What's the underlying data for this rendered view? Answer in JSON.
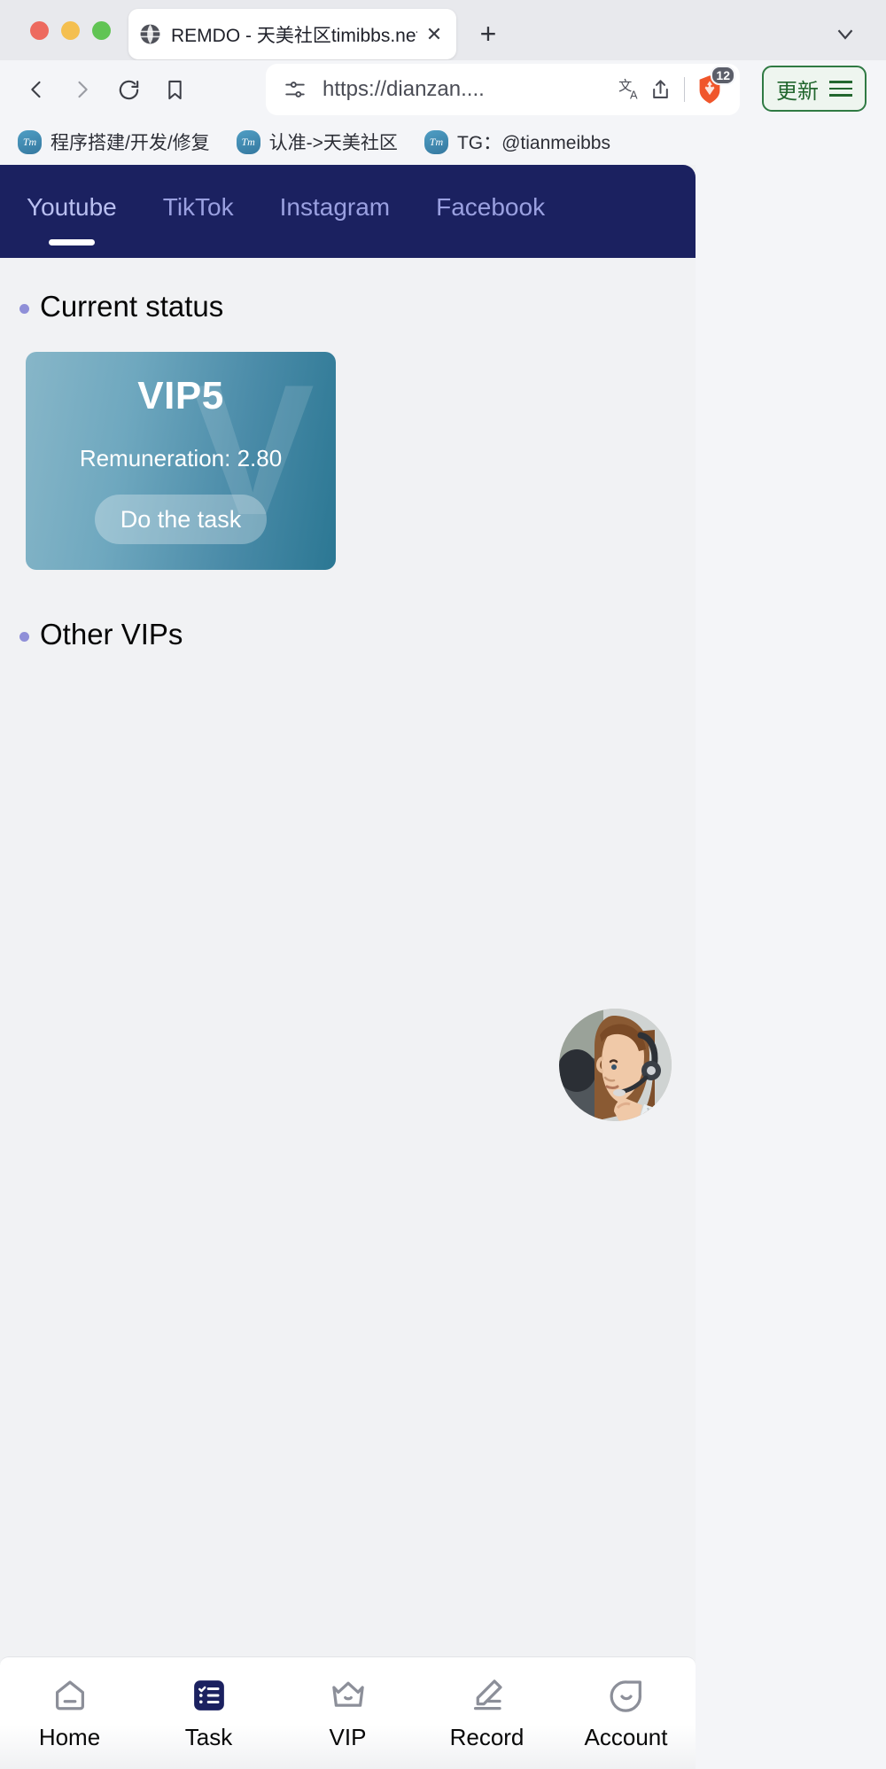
{
  "browser": {
    "tab": {
      "title": "REMDO - 天美社区timibbs.net",
      "favicon_icon": "globe-icon",
      "close_icon": "close-icon"
    },
    "new_tab_icon": "plus-icon",
    "tab_list_icon": "chevron-down-icon",
    "toolbar": {
      "back_icon": "back-arrow-icon",
      "forward_icon": "forward-arrow-icon",
      "reload_icon": "reload-icon",
      "bookmark_icon": "bookmark-icon",
      "permissions_icon": "site-settings-icon",
      "url": "https://dianzan....",
      "translate_icon": "translate-icon",
      "share_icon": "share-icon",
      "shield_icon": "brave-shield-lion-icon",
      "shield_count": "12",
      "update_label": "更新",
      "menu_icon": "hamburger-menu-icon"
    },
    "bookmarks": [
      {
        "icon": "tm-icon",
        "icon_text": "Tm",
        "label": "程序搭建/开发/修复"
      },
      {
        "icon": "tm-icon",
        "icon_text": "Tm",
        "label": "认准->天美社区"
      },
      {
        "icon": "tm-icon",
        "icon_text": "Tm",
        "label": "TG：@tianmeibbs"
      }
    ]
  },
  "page": {
    "nav_tabs": [
      {
        "label": "Youtube",
        "active": true
      },
      {
        "label": "TikTok",
        "active": false
      },
      {
        "label": "Instagram",
        "active": false
      },
      {
        "label": "Facebook",
        "active": false
      }
    ],
    "sections": {
      "current_status": "Current status",
      "other_vips": "Other VIPs"
    },
    "vip_card": {
      "level": "VIP5",
      "watermark": "V",
      "remuneration": "Remuneration: 2.80",
      "button": "Do the task"
    },
    "support": {
      "icon": "customer-support-avatar"
    },
    "bottom_nav": [
      {
        "label": "Home",
        "icon": "home-icon",
        "active": false
      },
      {
        "label": "Task",
        "icon": "task-list-icon",
        "active": true
      },
      {
        "label": "VIP",
        "icon": "crown-icon",
        "active": false
      },
      {
        "label": "Record",
        "icon": "pencil-edit-icon",
        "active": false
      },
      {
        "label": "Account",
        "icon": "account-smiley-icon",
        "active": false
      }
    ]
  },
  "colors": {
    "nav_bg": "#1b2160",
    "nav_tab_text": "#9aa0e0",
    "card_start": "#87b6c8",
    "card_end": "#2b7793",
    "active_tab_icon": "#1b2160",
    "update_green": "#23672f",
    "brave_orange": "#f0562b"
  }
}
